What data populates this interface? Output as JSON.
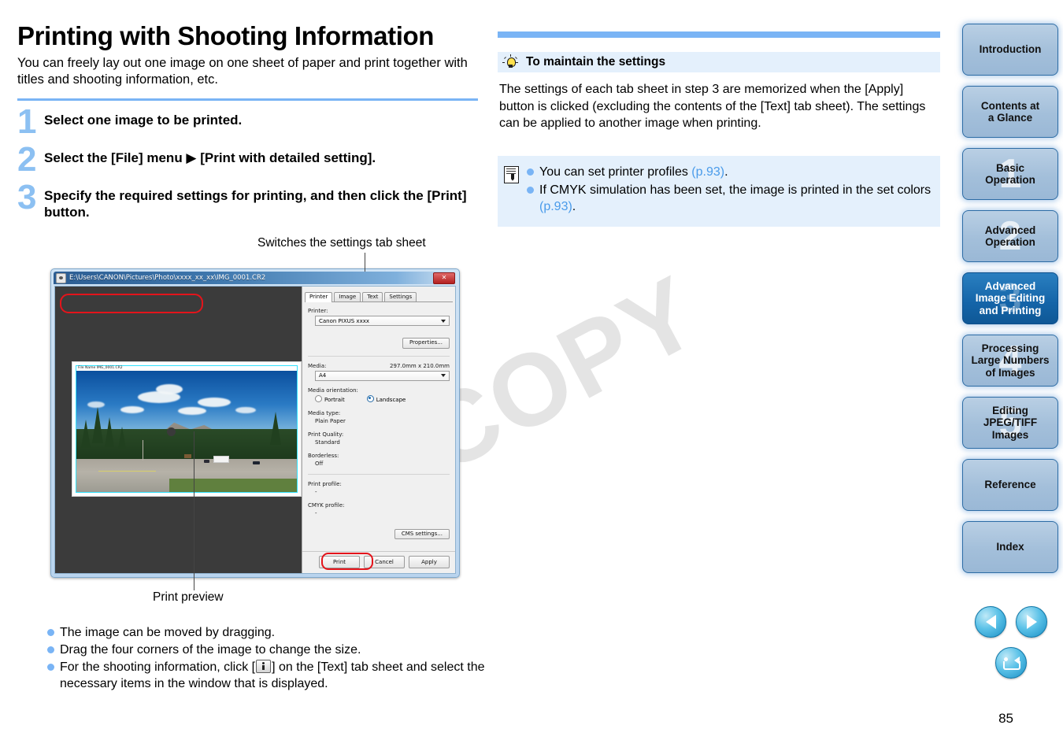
{
  "document": {
    "title": "Printing with Shooting Information",
    "intro": "You can freely lay out one image on one sheet of paper and print together with titles and shooting information, etc.",
    "page_number": "85",
    "watermark": "COPY"
  },
  "steps": [
    {
      "num": "1",
      "text": "Select one image to be printed."
    },
    {
      "num": "2",
      "text": "Select the [File] menu ▶ [Print with detailed setting]."
    },
    {
      "num": "3",
      "text": "Specify the required settings for printing, and then click the [Print] button."
    }
  ],
  "callouts": {
    "tab_sheet": "Switches the settings tab sheet",
    "print_preview": "Print preview"
  },
  "dialog": {
    "title": "E:\\Users\\CANON\\Pictures\\Photo\\xxxx_xx_xx\\IMG_0001.CR2",
    "close_label": "✕",
    "tabs": [
      {
        "label": "Printer",
        "active": true
      },
      {
        "label": "Image",
        "active": false
      },
      {
        "label": "Text",
        "active": false
      },
      {
        "label": "Settings",
        "active": false
      }
    ],
    "preview_filename": "File Name IMG_0001.CR2",
    "fields": {
      "printer_label": "Printer:",
      "printer_value": "Canon PIXUS xxxx",
      "properties_button": "Properties...",
      "media_label": "Media:",
      "media_size": "297.0mm x 210.0mm",
      "media_value": "A4",
      "orientation_label": "Media orientation:",
      "orientation_portrait": "Portrait",
      "orientation_landscape": "Landscape",
      "media_type_label": "Media type:",
      "media_type_value": "Plain Paper",
      "print_quality_label": "Print Quality:",
      "print_quality_value": "Standard",
      "borderless_label": "Borderless:",
      "borderless_value": "Off",
      "print_profile_label": "Print profile:",
      "print_profile_value": "-",
      "cmyk_profile_label": "CMYK profile:",
      "cmyk_profile_value": "-",
      "cms_settings_button": "CMS settings..."
    },
    "buttons": {
      "print": "Print",
      "cancel": "Cancel",
      "apply": "Apply"
    }
  },
  "bullets": [
    "The image can be moved by dragging.",
    "Drag the four corners of the image to change the size.",
    "For the shooting information, click [ ] on the [Text] tab sheet and select the necessary items in the window that is displayed."
  ],
  "bullet3": {
    "before": "For the shooting information, click [",
    "after": "] on the [Text] tab sheet and select the necessary items in the window that is displayed."
  },
  "tip": {
    "title": "To maintain the settings",
    "body": "The settings of each tab sheet in step 3 are memorized when the [Apply] button is clicked (excluding the contents of the [Text] tab sheet). The settings can be applied to another image when printing."
  },
  "note": {
    "items": [
      {
        "text": "You can set printer profiles ",
        "ref": "(p.93)",
        "tail": "."
      },
      {
        "text": "If CMYK simulation has been set, the image is printed in the set colors ",
        "ref": "(p.93)",
        "tail": "."
      }
    ]
  },
  "sidebar": {
    "items": [
      {
        "label": "Introduction",
        "ghost": "",
        "active": false
      },
      {
        "label": "Contents at\na Glance",
        "ghost": "",
        "active": false
      },
      {
        "label": "Basic\nOperation",
        "ghost": "1",
        "active": false
      },
      {
        "label": "Advanced\nOperation",
        "ghost": "2",
        "active": false
      },
      {
        "label": "Advanced\nImage Editing\nand Printing",
        "ghost": "3",
        "active": true
      },
      {
        "label": "Processing\nLarge Numbers\nof Images",
        "ghost": "4",
        "active": false
      },
      {
        "label": "Editing\nJPEG/TIFF\nImages",
        "ghost": "5",
        "active": false
      },
      {
        "label": "Reference",
        "ghost": "",
        "active": false
      },
      {
        "label": "Index",
        "ghost": "",
        "active": false
      }
    ]
  },
  "colors": {
    "accent_blue": "#7ab4f5",
    "link_blue": "#4a9bea",
    "tip_bg": "#e4f0fc",
    "sidebar_active": "#1464a8",
    "highlight_red": "#e4141b",
    "watermark_gray": "#e4e4e4"
  }
}
